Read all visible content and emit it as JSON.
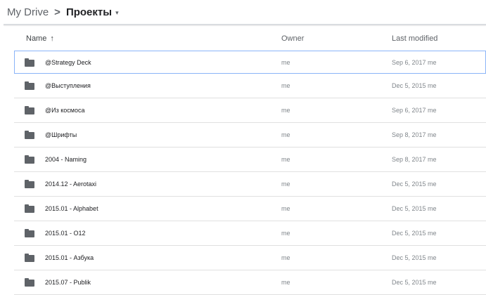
{
  "breadcrumb": {
    "root": "My Drive",
    "separator": ">",
    "current": "Проекты",
    "caret": "▾"
  },
  "table": {
    "headers": {
      "name": "Name",
      "sort_arrow": "↑",
      "owner": "Owner",
      "modified": "Last modified"
    },
    "rows": [
      {
        "name": "@Strategy Deck",
        "owner": "me",
        "modified": "Sep 6, 2017 me"
      },
      {
        "name": "@Выступления",
        "owner": "me",
        "modified": "Dec 5, 2015 me"
      },
      {
        "name": "@Из космоса",
        "owner": "me",
        "modified": "Sep 6, 2017 me"
      },
      {
        "name": "@Шрифты",
        "owner": "me",
        "modified": "Sep 8, 2017 me"
      },
      {
        "name": "2004 - Naming",
        "owner": "me",
        "modified": "Sep 8, 2017 me"
      },
      {
        "name": "2014.12 - Aerotaxi",
        "owner": "me",
        "modified": "Dec 5, 2015 me"
      },
      {
        "name": "2015.01 - Alphabet",
        "owner": "me",
        "modified": "Dec 5, 2015 me"
      },
      {
        "name": "2015.01 - O12",
        "owner": "me",
        "modified": "Dec 5, 2015 me"
      },
      {
        "name": "2015.01 - Азбука",
        "owner": "me",
        "modified": "Dec 5, 2015 me"
      },
      {
        "name": "2015.07 - Publik",
        "owner": "me",
        "modified": "Dec 5, 2015 me"
      }
    ]
  },
  "icons": {
    "folder": "folder-icon"
  }
}
